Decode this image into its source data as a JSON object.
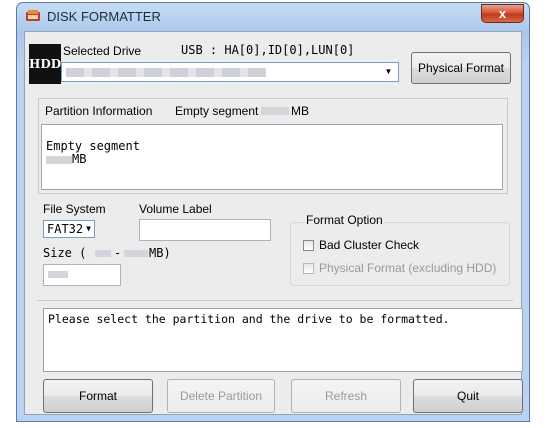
{
  "window": {
    "title": "DISK FORMATTER",
    "close_glyph": "x"
  },
  "drive": {
    "badge": "HDD",
    "selected_drive_label": "Selected Drive",
    "usb_info": "USB : HA[0],ID[0],LUN[0]",
    "physical_format_label": "Physical Format"
  },
  "partition": {
    "info_label": "Partition Information",
    "empty_segment_label": "Empty segment :",
    "empty_segment_unit": "MB",
    "box_line1": "Empty segment",
    "box_unit": "MB"
  },
  "format_options": {
    "file_system_label": "File System",
    "file_system_value": "FAT32",
    "volume_label": "Volume Label",
    "size_label": "Size (",
    "size_dash": "-",
    "size_unit": "MB)",
    "format_option_legend": "Format Option",
    "bad_cluster_label": "Bad Cluster Check",
    "physical_format_excl_label": "Physical Format (excluding HDD)"
  },
  "status": {
    "message": "Please select the partition and the drive to be formatted."
  },
  "buttons": {
    "format": "Format",
    "delete_partition": "Delete Partition",
    "refresh": "Refresh",
    "quit": "Quit"
  },
  "icons": {
    "app_icon": "disk-formatter-icon",
    "dropdown": "chevron-down-icon"
  }
}
